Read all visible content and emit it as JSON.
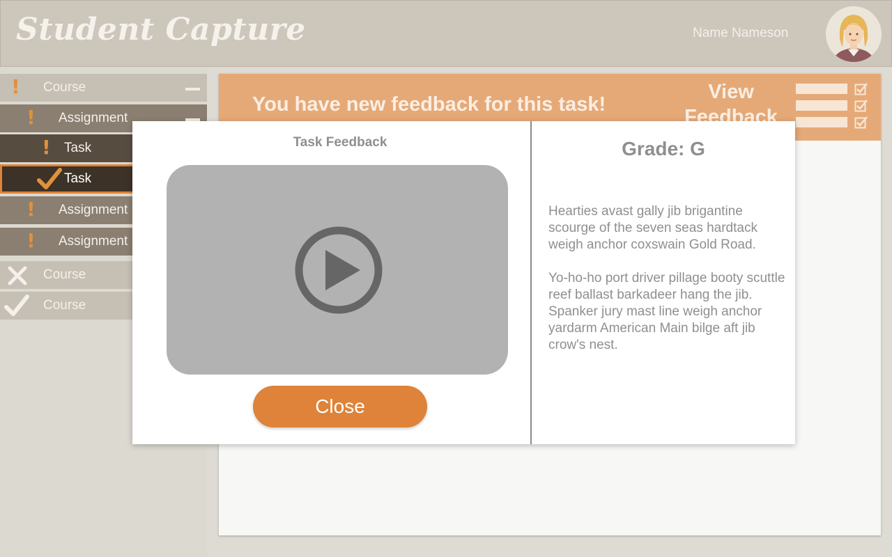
{
  "header": {
    "app_title": "Student Capture",
    "user_name": "Name Nameson"
  },
  "sidebar": {
    "items": [
      {
        "label": "Course",
        "status_icon": "exclamation-icon",
        "expanded": true
      },
      {
        "label": "Assignment",
        "status_icon": "exclamation-icon",
        "expanded": true
      },
      {
        "label": "Task",
        "status_icon": "exclamation-icon"
      },
      {
        "label": "Task",
        "status_icon": "checkmark-icon",
        "selected": true
      },
      {
        "label": "Assignment",
        "status_icon": "exclamation-icon"
      },
      {
        "label": "Assignment",
        "status_icon": "exclamation-icon"
      },
      {
        "label": "Course",
        "status_icon": "x-icon"
      },
      {
        "label": "Course",
        "status_icon": "checkmark-icon"
      }
    ]
  },
  "banner": {
    "message": "You have new feedback for this task!",
    "view_feedback_label": "View Feedback"
  },
  "modal": {
    "title": "Task Feedback",
    "close_label": "Close",
    "grade": "Grade: G",
    "feedback_paragraphs": [
      "Hearties avast gally jib brigantine scourge of the seven seas hardtack weigh anchor coxswain Gold Road.",
      "Yo-ho-ho port driver pillage booty scuttle reef ballast barkadeer hang the jib. Spanker jury mast line weigh anchor yardarm American Main bilge aft jib crow's nest."
    ]
  },
  "colors": {
    "accent_orange": "#de8339",
    "banner_orange": "#e5a978",
    "header_beige": "#cdc6bb",
    "selected_dark": "#3c3227"
  }
}
